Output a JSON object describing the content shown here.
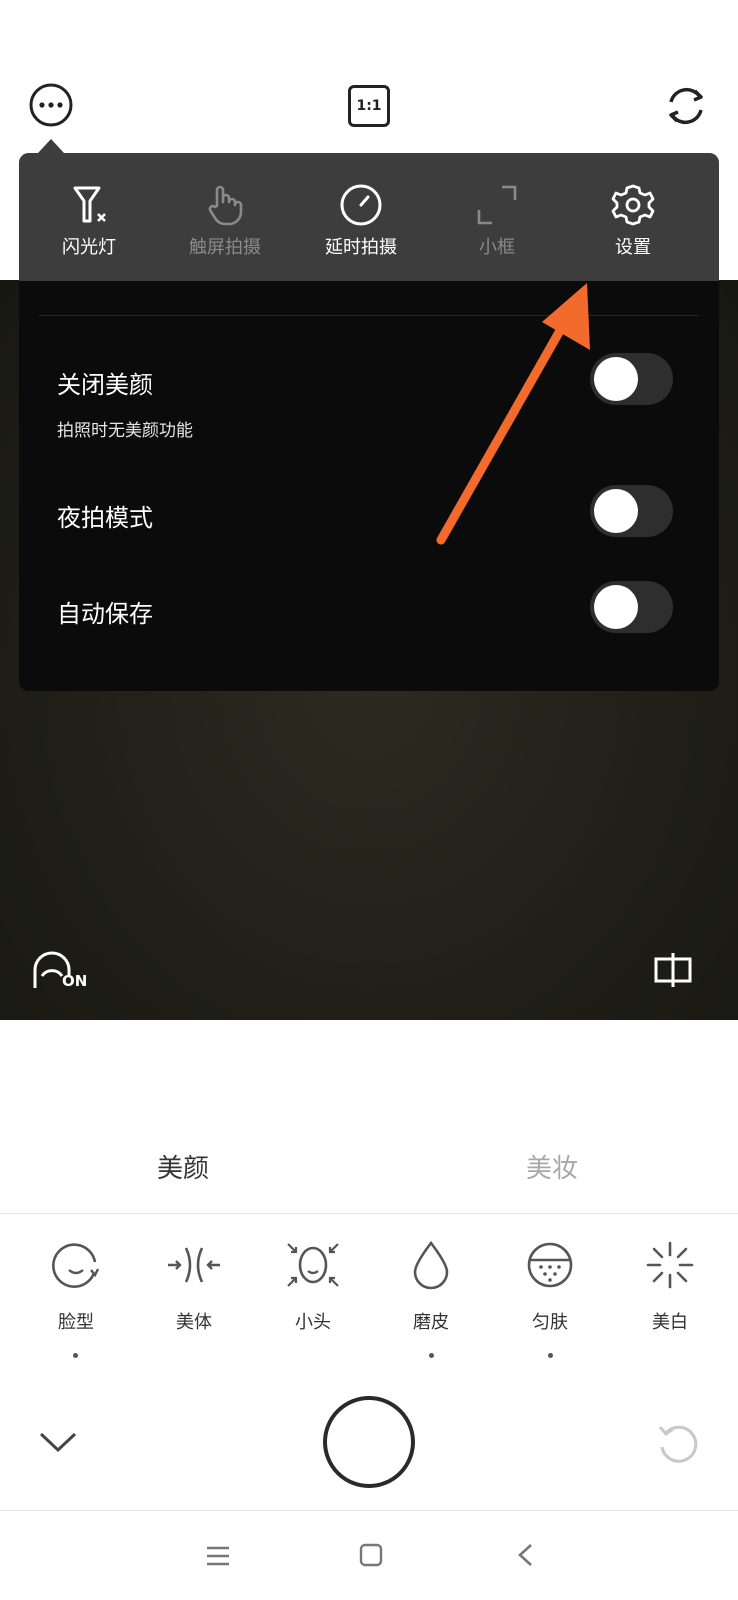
{
  "top_bar": {
    "more_icon": "more-dots-icon",
    "ratio_label": "1:1",
    "switch_icon": "camera-switch-icon"
  },
  "settings_panel": {
    "tools": [
      {
        "label": "闪光灯",
        "icon": "flash-off-icon",
        "enabled": true
      },
      {
        "label": "触屏拍摄",
        "icon": "touch-hand-icon",
        "enabled": false
      },
      {
        "label": "延时拍摄",
        "icon": "timer-icon",
        "enabled": true
      },
      {
        "label": "小框",
        "icon": "small-frame-icon",
        "enabled": false
      },
      {
        "label": "设置",
        "icon": "gear-icon",
        "enabled": true
      }
    ],
    "options": [
      {
        "title": "关闭美颜",
        "subtitle": "拍照时无美颜功能",
        "on": false
      },
      {
        "title": "夜拍模式",
        "on": false
      },
      {
        "title": "自动保存",
        "on": false
      }
    ]
  },
  "preview": {
    "beauty_badge": "ON",
    "split_icon": "split-view-icon"
  },
  "beauty_tabs": [
    {
      "label": "美颜",
      "active": true
    },
    {
      "label": "美妆",
      "active": false
    }
  ],
  "features": [
    {
      "label": "脸型",
      "icon": "face-shape-icon",
      "dot": true
    },
    {
      "label": "美体",
      "icon": "body-shape-icon",
      "dot": false
    },
    {
      "label": "小头",
      "icon": "small-head-icon",
      "dot": false
    },
    {
      "label": "磨皮",
      "icon": "smooth-skin-icon",
      "dot": true
    },
    {
      "label": "匀肤",
      "icon": "even-skin-icon",
      "dot": true
    },
    {
      "label": "美白",
      "icon": "whitening-icon",
      "dot": false
    }
  ],
  "colors": {
    "arrow": "#f26a2c",
    "panel_top": "#3d3d3d",
    "panel_body": "#0b0b0b",
    "active_tab": "#333333",
    "inactive_tab": "#999999"
  }
}
